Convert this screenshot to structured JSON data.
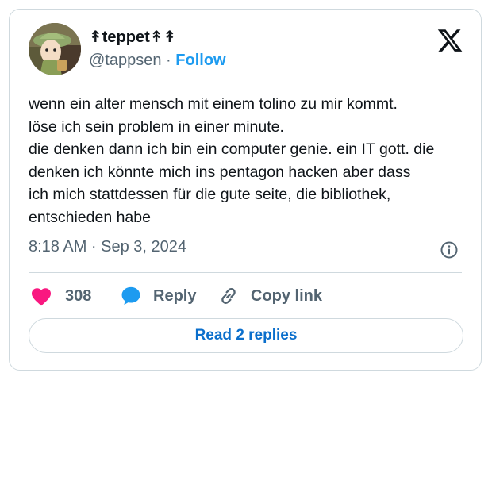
{
  "author": {
    "display_name": "↟teppet↟↟",
    "handle": "@tappsen",
    "separator": "·",
    "follow_label": "Follow"
  },
  "tweet": {
    "lines": [
      "wenn ein alter mensch mit einem tolino zu mir kommt.",
      "löse ich sein problem in einer minute.",
      "die denken dann ich bin ein computer genie. ein IT gott. die",
      "denken ich könnte mich ins pentagon hacken aber dass",
      "ich mich stattdessen für die gute seite, die bibliothek,",
      "entschieden habe"
    ],
    "timestamp": "8:18 AM · Sep 3, 2024"
  },
  "actions": {
    "like_count": "308",
    "reply_label": "Reply",
    "copy_label": "Copy link"
  },
  "read_replies_label": "Read 2 replies",
  "icons": {
    "platform_logo": "x-logo-icon",
    "info": "info-icon",
    "like": "heart-icon",
    "reply": "speech-bubble-icon",
    "copy": "link-icon"
  },
  "colors": {
    "like": "#f91880",
    "reply": "#1d9bf0",
    "follow": "#1d9bf0",
    "read_replies": "#0b6fcc"
  }
}
